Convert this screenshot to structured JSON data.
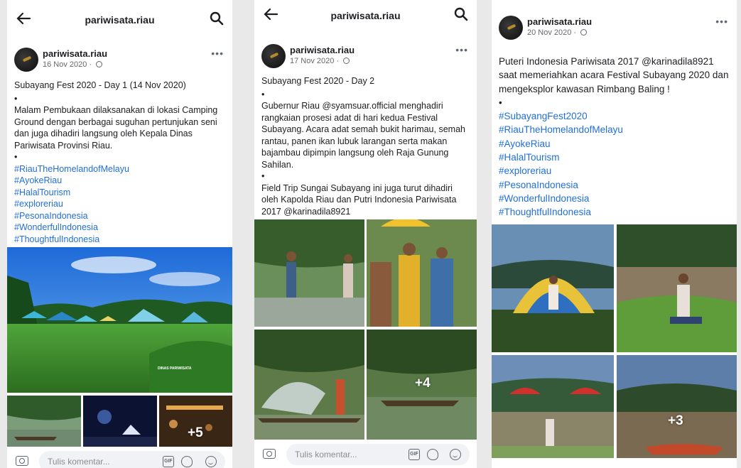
{
  "post1": {
    "page_title": "pariwisata.riau",
    "author": "pariwisata.riau",
    "date": "16 Nov 2020 · ",
    "caption": [
      "Subayang Fest 2020 - Day 1 (14 Nov 2020)",
      "•",
      "Malam Pembukaan dilaksanakan di lokasi Camping Ground dengan berbagai suguhan pertunjukan seni dan juga dihadiri langsung oleh Kepala Dinas Pariwisata Provinsi Riau.",
      "•"
    ],
    "hashtags": [
      "#RiauTheHomelandofMelayu",
      "#AyokeRiau",
      "#HalalTourism",
      "#exploreriau",
      "#PesonaIndonesia",
      "#WonderfulIndonesia",
      "#ThoughtfulIndonesia"
    ],
    "watermark": "DINAS PARIWISATA",
    "more_photos": "+5",
    "comment_placeholder": "Tulis komentar...",
    "gif_label": "GIF"
  },
  "post2": {
    "page_title": "pariwisata.riau",
    "author": "pariwisata.riau",
    "date": "17 Nov 2020 · ",
    "caption": [
      "Subayang Fest 2020 - Day 2",
      "•",
      "Gubernur Riau @syamsuar.official menghadiri rangkaian prosesi adat di hari kedua Festival Subayang. Acara adat semah bukit harimau, semah rantau, panen ikan lubuk larangan serta makan bajambau dipimpin langsung oleh Raja Gunung Sahilan.",
      "•",
      "Field Trip Sungai Subayang ini juga turut dihadiri oleh Kapolda Riau dan Putri Indonesia Pariwisata 2017 @karinadila8921"
    ],
    "more_photos": "+4",
    "comment_placeholder": "Tulis komentar...",
    "gif_label": "GIF"
  },
  "post3": {
    "author": "pariwisata.riau",
    "date": "20 Nov 2020 · ",
    "caption": [
      "Puteri Indonesia Pariwisata 2017 @karinadila8921 saat memeriahkan acara Festival Subayang 2020 dan mengeksplor kawasan Rimbang Baling !",
      "•"
    ],
    "hashtags": [
      "#SubayangFest2020",
      "#RiauTheHomelandofMelayu",
      "#AyokeRiau",
      "#HalalTourism",
      "#exploreriau",
      "#PesonaIndonesia",
      "#WonderfulIndonesia",
      "#ThoughtfulIndonesia"
    ],
    "more_photos": "+3"
  },
  "icons": {
    "back": "back-arrow-icon",
    "search": "search-icon",
    "more": "more-options-icon",
    "globe": "globe-icon",
    "camera": "camera-icon",
    "gif": "gif-icon",
    "sticker": "sticker-icon",
    "emoji": "emoji-icon"
  },
  "colors": {
    "hashtag": "#216fdb",
    "text": "#1c1e21",
    "secondary": "#65676b"
  }
}
